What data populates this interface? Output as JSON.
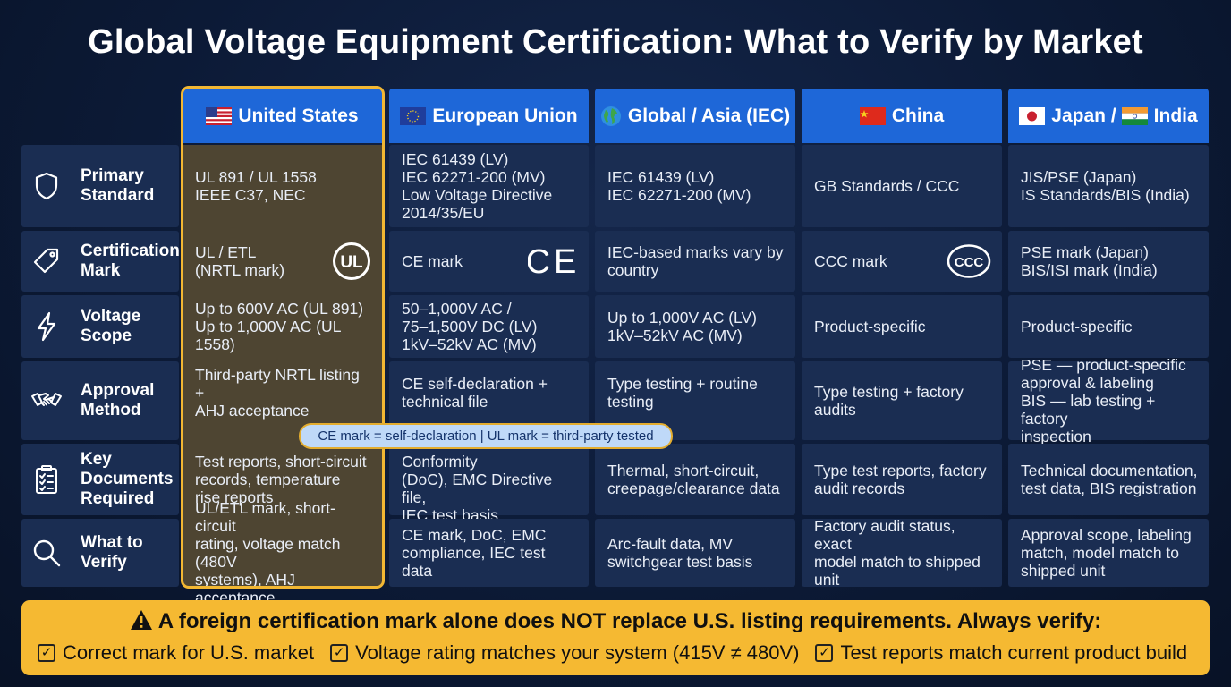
{
  "title": "Global Voltage Equipment Certification: What to Verify by Market",
  "columns": [
    {
      "label": "United States",
      "flag": "us-flag"
    },
    {
      "label": "European Union",
      "flag": "eu-flag"
    },
    {
      "label": "Global / Asia (IEC)",
      "flag": "globe-icon"
    },
    {
      "label": "China",
      "flag": "china-flag"
    },
    {
      "label_a": "Japan /",
      "label_b": "India",
      "flag": "japan-flag",
      "flag_b": "india-flag"
    }
  ],
  "rows": [
    {
      "label": "Primary\nStandard",
      "icon": "shield-icon",
      "cells": [
        "UL 891 / UL 1558\nIEEE C37, NEC",
        "IEC 61439 (LV)\nIEC 62271-200 (MV)\nLow Voltage Directive\n2014/35/EU",
        "IEC 61439 (LV)\nIEC 62271-200 (MV)",
        "GB Standards / CCC",
        "JIS/PSE (Japan)\nIS Standards/BIS (India)"
      ]
    },
    {
      "label": "Certification\nMark",
      "icon": "tag-icon",
      "cells": [
        "UL / ETL\n(NRTL mark)",
        "CE mark",
        "IEC-based marks vary by\ncountry",
        "CCC mark",
        "PSE mark (Japan)\nBIS/ISI mark (India)"
      ],
      "marks": {
        "us": "UL",
        "eu": "CE",
        "china": "CCC"
      }
    },
    {
      "label": "Voltage\nScope",
      "icon": "lightning-icon",
      "cells": [
        "Up to 600V AC (UL 891)\nUp to 1,000V AC (UL 1558)",
        "50–1,000V AC /\n75–1,500V DC (LV)\n1kV–52kV AC (MV)",
        "Up to 1,000V AC (LV)\n1kV–52kV AC (MV)",
        "Product-specific",
        "Product-specific"
      ]
    },
    {
      "label": "Approval\nMethod",
      "icon": "handshake-icon",
      "cells": [
        "Third-party NRTL listing +\nAHJ acceptance",
        "CE self-declaration +\ntechnical file",
        "Type testing + routine\ntesting",
        "Type testing + factory\naudits",
        "PSE — product-specific\napproval & labeling\nBIS — lab testing + factory\ninspection"
      ]
    },
    {
      "label": "Key\nDocuments\nRequired",
      "icon": "clipboard-icon",
      "cells": [
        "Test reports, short-circuit\nrecords, temperature\nrise reports",
        "Declaration of Conformity\n(DoC), EMC Directive file,\nIEC test basis",
        "Thermal, short-circuit,\ncreepage/clearance data",
        "Type test reports, factory\naudit records",
        "Technical documentation,\ntest data, BIS registration"
      ]
    },
    {
      "label": "What to\nVerify",
      "icon": "magnifier-icon",
      "cells": [
        "UL/ETL mark, short-circuit\nrating, voltage match (480V\nsystems), AHJ acceptance",
        "CE mark, DoC, EMC\ncompliance, IEC test data",
        "Arc-fault data, MV\nswitchgear test basis",
        "Factory audit status, exact\nmodel match to shipped\nunit",
        "Approval scope, labeling\nmatch, model match to\nshipped unit"
      ]
    }
  ],
  "callout": "CE mark = self-declaration | UL mark = third-party tested",
  "banner": {
    "warning": "A foreign certification mark alone does NOT replace U.S. listing requirements. Always verify:",
    "warning_icon": "warning-icon",
    "checks": [
      "Correct mark for U.S. market",
      "Voltage rating matches your system (415V ≠ 480V)",
      "Test reports match current product build"
    ],
    "check_icon": "checkbox-icon"
  },
  "colors": {
    "header_blue": "#1e67d8",
    "cell_bg": "#1a2d52",
    "us_highlight": "#f2b733",
    "banner": "#f5b932"
  }
}
